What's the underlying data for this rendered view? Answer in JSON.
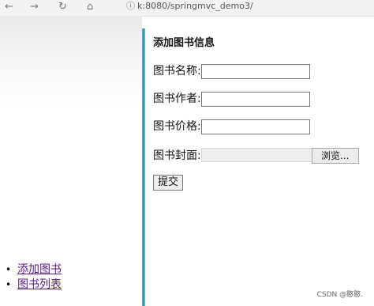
{
  "browser": {
    "address_url": "k:8080/springmvc_demo3/"
  },
  "form": {
    "title": "添加图书信息",
    "name_label": "图书名称:",
    "name_value": "",
    "author_label": "图书作者:",
    "author_value": "",
    "price_label": "图书价格:",
    "price_value": "",
    "cover_label": "图书封面:",
    "browse_label": "浏览...",
    "submit_label": "提交"
  },
  "nav": {
    "items": [
      {
        "label": "添加图书"
      },
      {
        "label": "图书列表"
      }
    ]
  },
  "watermark": "CSDN @憨憨."
}
